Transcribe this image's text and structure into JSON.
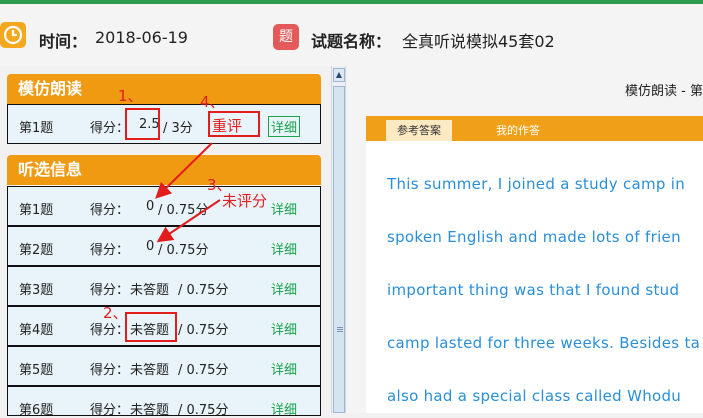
{
  "header": {
    "time_icon": "clock-icon",
    "time_label": "时间：",
    "time_value": "2018-06-19",
    "title_icon_text": "题",
    "title_label": "试题名称：",
    "title_value": "全真听说模拟45套02",
    "accent_green": "#2e9c4c",
    "orange": "#f09a12"
  },
  "sections": [
    {
      "title": "模仿朗读",
      "rows": [
        {
          "q": "第1题",
          "score_label": "得分：",
          "score": "2.5",
          "total": "/ 3分",
          "detail": "详细"
        }
      ]
    },
    {
      "title": "听选信息",
      "rows": [
        {
          "q": "第1题",
          "score_label": "得分：",
          "score": "0",
          "total": "/ 0.75分",
          "detail": "详细"
        },
        {
          "q": "第2题",
          "score_label": "得分：",
          "score": "0",
          "total": "/ 0.75分",
          "detail": "详细"
        },
        {
          "q": "第3题",
          "score_label": "得分：",
          "score": "未答题",
          "total": "/ 0.75分",
          "detail": "详细"
        },
        {
          "q": "第4题",
          "score_label": "得分：",
          "score": "未答题",
          "total": "/ 0.75分",
          "detail": "详细"
        },
        {
          "q": "第5题",
          "score_label": "得分：",
          "score": "未答题",
          "total": "/ 0.75分",
          "detail": "详细"
        },
        {
          "q": "第6题",
          "score_label": "得分：",
          "score": "未答题",
          "total": "/ 0.75分",
          "detail": "详细"
        }
      ]
    }
  ],
  "right": {
    "title": "模仿朗读 - 第",
    "tabs": [
      "参考答案",
      "我的作答"
    ],
    "active_tab": "参考答案",
    "lines": [
      "This  summer, I  joined  a  study  camp  in",
      "spoken  English  and  made  lots  of  frien",
      "important  thing  was  that  I  found  stud",
      "camp  lasted  for  three  weeks. Besides  ta",
      "also  had  a  special  class  called  Whodu"
    ]
  },
  "annotations": {
    "a1": "1、",
    "a2": "2、",
    "a3": "3、",
    "a3_text": "未评分",
    "a4": "4、",
    "a4_text": "重评"
  }
}
